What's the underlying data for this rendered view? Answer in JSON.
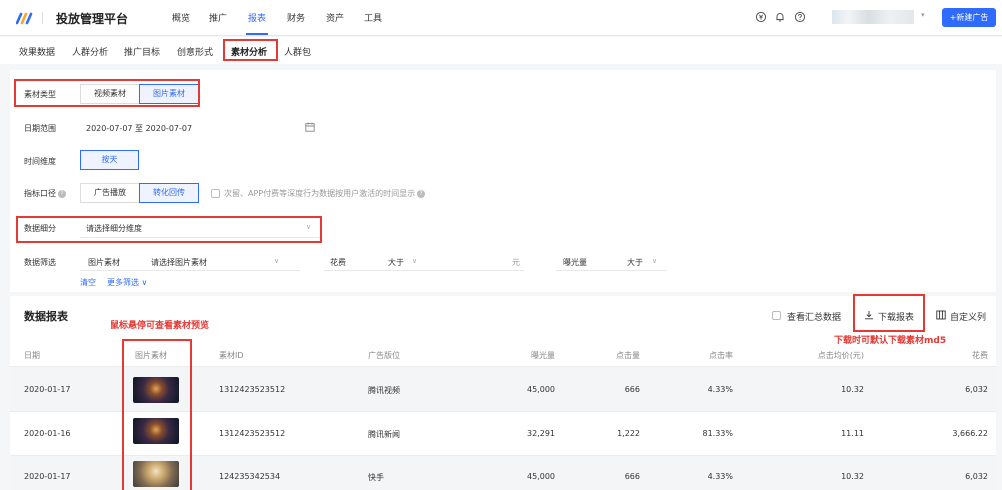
{
  "header": {
    "app_title": "投放管理平台",
    "nav": [
      "概览",
      "推广",
      "报表",
      "财务",
      "资产",
      "工具"
    ],
    "active_nav": "报表",
    "new_ad_button": "+新建广告",
    "accent_color": "#2f6bff"
  },
  "subnav": {
    "tabs": [
      "效果数据",
      "人群分析",
      "推广目标",
      "创意形式",
      "素材分析",
      "人群包"
    ],
    "active_tab": "素材分析"
  },
  "filters": {
    "material_type": {
      "label": "素材类型",
      "options": [
        "视频素材",
        "图片素材"
      ],
      "selected": "图片素材"
    },
    "date_range": {
      "label": "日期范围",
      "value": "2020-07-07 至 2020-07-07"
    },
    "time_dimension": {
      "label": "时间维度",
      "option": "按天"
    },
    "indicator_caliber": {
      "label": "指标口径",
      "options": [
        "广告播放",
        "转化回传"
      ],
      "selected": "转化回传",
      "checkbox_label": "次留、APP付费等深度行为数据按用户激活的时间显示"
    },
    "data_breakdown": {
      "label": "数据细分",
      "placeholder": "请选择细分维度"
    },
    "data_filter": {
      "label": "数据筛选",
      "field1": "图片素材",
      "field1_placeholder": "请选择图片素材",
      "field2": "花费",
      "field2_op": "大于",
      "field2_unit": "元",
      "field3": "曝光量",
      "field3_op": "大于"
    },
    "clear_link": "清空",
    "more_link": "更多筛选"
  },
  "report": {
    "title": "数据报表",
    "hover_annotation": "鼠标悬停可查看素材预览",
    "summary_checkbox": "查看汇总数据",
    "download_button": "下载报表",
    "download_annotation": "下载时可默认下载素材md5",
    "customize_button": "自定义列",
    "columns": [
      "日期",
      "图片素材",
      "素材ID",
      "广告版位",
      "曝光量",
      "点击量",
      "点击率",
      "点击均价(元)",
      "花费"
    ],
    "rows": [
      {
        "date": "2020-01-17",
        "material_id": "1312423523512",
        "placement": "腾讯视频",
        "impressions": "45,000",
        "clicks": "666",
        "ctr": "4.33%",
        "cpc": "10.32",
        "cost": "6,032"
      },
      {
        "date": "2020-01-16",
        "material_id": "1312423523512",
        "placement": "腾讯新闻",
        "impressions": "32,291",
        "clicks": "1,222",
        "ctr": "81.33%",
        "cpc": "11.11",
        "cost": "3,666.22"
      },
      {
        "date": "2020-01-17",
        "material_id": "124235342534",
        "placement": "快手",
        "impressions": "45,000",
        "clicks": "666",
        "ctr": "4.33%",
        "cpc": "10.32",
        "cost": "6,032"
      }
    ]
  },
  "annotation_color": "#e53935"
}
